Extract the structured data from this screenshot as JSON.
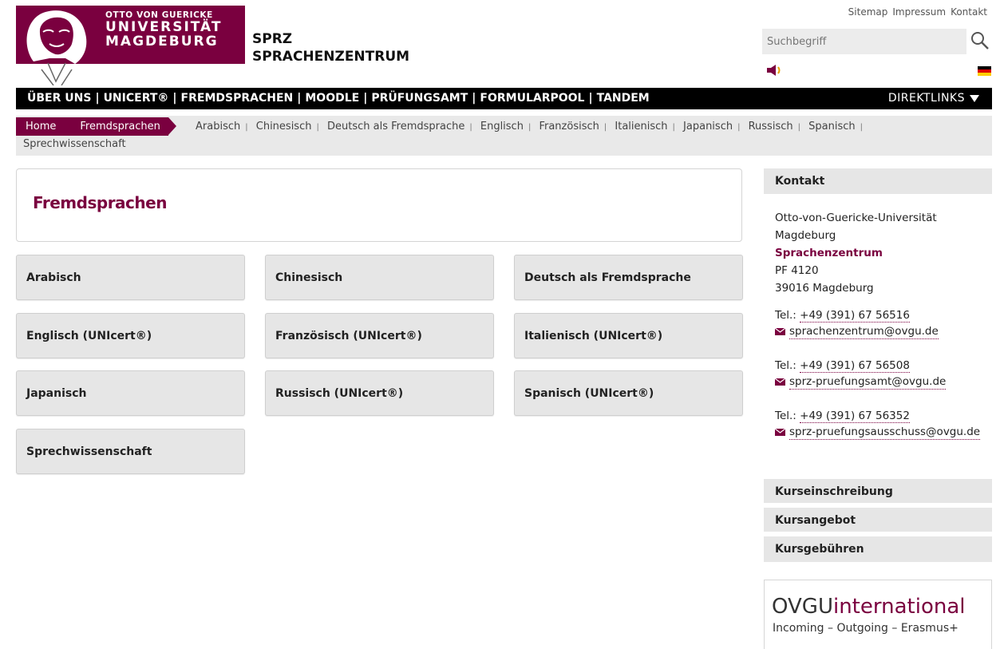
{
  "logo": {
    "line1": "OTTO VON GUERICKE",
    "line2": "UNIVERSITÄT",
    "line3": "MAGDEBURG"
  },
  "site": {
    "line1": "SPRZ",
    "line2": "SPRACHENZENTRUM"
  },
  "toplinks": [
    "Sitemap",
    "Impressum",
    "Kontakt"
  ],
  "search": {
    "placeholder": "Suchbegriff"
  },
  "nav": {
    "items": [
      "ÜBER UNS",
      "UNICERT®",
      "FREMDSPRACHEN",
      "MOODLE",
      "PRÜFUNGSAMT",
      "FORMULARPOOL",
      "TANDEM"
    ],
    "direktlinks": "DIREKTLINKS"
  },
  "breadcrumb": {
    "home": "Home",
    "current": "Fremdsprachen",
    "links": [
      "Arabisch",
      "Chinesisch",
      "Deutsch als Fremdsprache",
      "Englisch",
      "Französisch",
      "Italienisch",
      "Japanisch",
      "Russisch",
      "Spanisch"
    ],
    "link_last": "Sprechwissenschaft"
  },
  "page_title": "Fremdsprachen",
  "tiles": [
    "Arabisch",
    "Chinesisch",
    "Deutsch als Fremdsprache",
    "Englisch (UNIcert®)",
    "Französisch (UNIcert®)",
    "Italienisch (UNIcert®)",
    "Japanisch",
    "Russisch (UNIcert®)",
    "Spanisch (UNIcert®)",
    "Sprechwissenschaft"
  ],
  "sidebar": {
    "kontakt_head": "Kontakt",
    "address": {
      "line1": "Otto-von-Guericke-Universität",
      "line2": "Magdeburg",
      "line3": "Sprachenzentrum",
      "line4": "PF 4120",
      "line5": "39016 Magdeburg"
    },
    "contacts": [
      {
        "tel_label": "Tel.:",
        "tel": "+49 (391) 67 56516",
        "email": "sprachenzentrum@ovgu.de"
      },
      {
        "tel_label": "Tel.:",
        "tel": "+49 (391) 67 56508",
        "email": "sprz-pruefungsamt@ovgu.de"
      },
      {
        "tel_label": "Tel.:",
        "tel": "+49 (391) 67 56352",
        "email": "sprz-pruefungsausschuss@ovgu.de"
      }
    ],
    "links": [
      "Kurseinschreibung",
      "Kursangebot",
      "Kursgebühren"
    ]
  },
  "ovgu_banner": {
    "ovgu": "OVGU",
    "international": "international",
    "sub": "Incoming – Outgoing – Erasmus+"
  },
  "colors": {
    "brand": "#7a003f",
    "nav_bg": "#000000",
    "tile_bg": "#e6e6e6"
  },
  "icons": [
    "search-icon",
    "speaker-icon",
    "german-flag-icon",
    "caret-down-icon",
    "mail-icon"
  ]
}
